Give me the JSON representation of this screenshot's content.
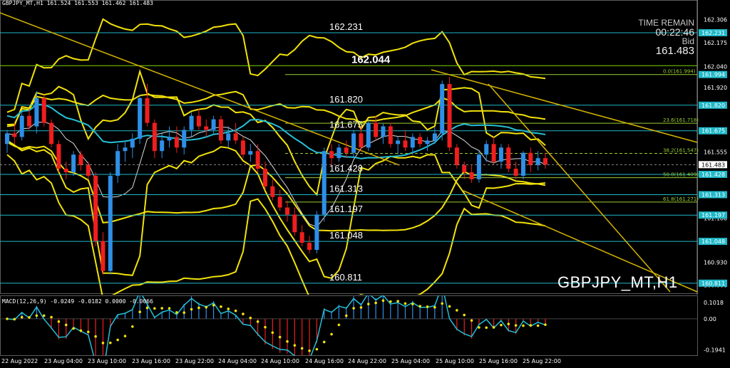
{
  "chart_title": "GBPJPY_MT,H1",
  "symbol_bar": "GBPJPY_MT,H1  161.524 161.553 161.462 161.483",
  "info": {
    "time_remain_label": "TIME REMAIN",
    "time_remain_value": "00:22:46",
    "bid_label": "Bid",
    "bid_value": "161.483"
  },
  "chart_data": {
    "type": "candlestick",
    "price_axis": {
      "ylim": [
        160.77,
        162.36
      ],
      "ticks": [
        "162.306",
        "162.175",
        "162.040",
        "161.920",
        "161.555",
        "161.180",
        "160.930",
        "160.800"
      ]
    },
    "price_level_tags": [
      "162.231",
      "161.994",
      "161.820",
      "161.675",
      "161.428",
      "161.313",
      "161.197",
      "161.048",
      "160.811"
    ],
    "current_price_tag": "161.483",
    "horizontal_levels": [
      {
        "label": "162.231",
        "value": 162.231,
        "line": "cyan",
        "label_color": "#ffffff"
      },
      {
        "label": "162.044",
        "value": 162.044,
        "line": "#7fd400",
        "label_color": "#ffffff",
        "bold": true
      },
      {
        "label": "161.820",
        "value": 161.82,
        "line": "cyan",
        "label_color": "#ffffff"
      },
      {
        "label": "161.675",
        "value": 161.675,
        "line": "cyan",
        "label_color": "#ffffff"
      },
      {
        "label": "161.428",
        "value": 161.428,
        "line": "cyan",
        "label_color": "#ffffff"
      },
      {
        "label": "161.313",
        "value": 161.313,
        "line": "cyan",
        "label_color": "#ffffff"
      },
      {
        "label": "161.197",
        "value": 161.197,
        "line": "cyan",
        "label_color": "#ffffff"
      },
      {
        "label": "161.048",
        "value": 161.048,
        "line": "cyan",
        "label_color": "#ffffff"
      },
      {
        "label": "160.811",
        "value": 160.811,
        "line": "cyan",
        "label_color": "#ffffff"
      }
    ],
    "fibo_levels": [
      {
        "label": "0.0(161.994)",
        "value": 161.994
      },
      {
        "label": "23.6(161.718)",
        "value": 161.718
      },
      {
        "label": "38.2(161.547)",
        "value": 161.547
      },
      {
        "label": "50.0(161.409)",
        "value": 161.409
      },
      {
        "label": "61.8(161.271)",
        "value": 161.271
      }
    ],
    "candles": [
      [
        161.6,
        161.68,
        161.55,
        161.66
      ],
      [
        161.66,
        161.72,
        161.6,
        161.64
      ],
      [
        161.64,
        161.78,
        161.62,
        161.76
      ],
      [
        161.76,
        161.8,
        161.68,
        161.7
      ],
      [
        161.7,
        161.9,
        161.66,
        161.86
      ],
      [
        161.86,
        161.88,
        161.7,
        161.72
      ],
      [
        161.72,
        161.74,
        161.58,
        161.6
      ],
      [
        161.6,
        161.62,
        161.44,
        161.46
      ],
      [
        161.46,
        161.5,
        161.4,
        161.44
      ],
      [
        161.44,
        161.56,
        161.42,
        161.54
      ],
      [
        161.54,
        161.56,
        161.45,
        161.48
      ],
      [
        161.48,
        161.5,
        161.4,
        161.42
      ],
      [
        161.42,
        161.44,
        161.02,
        161.05
      ],
      [
        161.05,
        161.1,
        160.86,
        160.88
      ],
      [
        160.88,
        161.44,
        160.86,
        161.42
      ],
      [
        161.42,
        161.6,
        161.38,
        161.56
      ],
      [
        161.56,
        161.62,
        161.5,
        161.58
      ],
      [
        161.58,
        161.66,
        161.52,
        161.63
      ],
      [
        161.63,
        161.88,
        161.6,
        161.86
      ],
      [
        161.86,
        161.94,
        161.7,
        161.72
      ],
      [
        161.72,
        161.74,
        161.52,
        161.56
      ],
      [
        161.56,
        161.66,
        161.52,
        161.62
      ],
      [
        161.62,
        161.7,
        161.58,
        161.64
      ],
      [
        161.64,
        161.7,
        161.55,
        161.58
      ],
      [
        161.58,
        161.7,
        161.54,
        161.68
      ],
      [
        161.68,
        161.78,
        161.64,
        161.76
      ],
      [
        161.76,
        161.8,
        161.68,
        161.7
      ],
      [
        161.7,
        161.74,
        161.64,
        161.68
      ],
      [
        161.68,
        161.76,
        161.66,
        161.74
      ],
      [
        161.74,
        161.76,
        161.6,
        161.62
      ],
      [
        161.62,
        161.7,
        161.58,
        161.66
      ],
      [
        161.66,
        161.72,
        161.6,
        161.62
      ],
      [
        161.62,
        161.64,
        161.52,
        161.54
      ],
      [
        161.54,
        161.6,
        161.5,
        161.56
      ],
      [
        161.56,
        161.6,
        161.44,
        161.46
      ],
      [
        161.46,
        161.5,
        161.34,
        161.36
      ],
      [
        161.36,
        161.4,
        161.28,
        161.3
      ],
      [
        161.3,
        161.34,
        161.22,
        161.24
      ],
      [
        161.24,
        161.28,
        161.16,
        161.2
      ],
      [
        161.2,
        161.24,
        161.08,
        161.1
      ],
      [
        161.1,
        161.14,
        161.02,
        161.04
      ],
      [
        161.04,
        161.08,
        160.98,
        161.0
      ],
      [
        161.0,
        161.22,
        160.98,
        161.2
      ],
      [
        161.2,
        161.58,
        161.16,
        161.56
      ],
      [
        161.56,
        161.6,
        161.48,
        161.52
      ],
      [
        161.52,
        161.6,
        161.5,
        161.58
      ],
      [
        161.58,
        161.62,
        161.52,
        161.55
      ],
      [
        161.55,
        161.68,
        161.52,
        161.66
      ],
      [
        161.66,
        161.7,
        161.56,
        161.58
      ],
      [
        161.58,
        161.74,
        161.56,
        161.72
      ],
      [
        161.72,
        161.76,
        161.62,
        161.64
      ],
      [
        161.64,
        161.72,
        161.6,
        161.7
      ],
      [
        161.7,
        161.72,
        161.58,
        161.6
      ],
      [
        161.6,
        161.64,
        161.54,
        161.62
      ],
      [
        161.62,
        161.68,
        161.56,
        161.58
      ],
      [
        161.58,
        161.66,
        161.54,
        161.64
      ],
      [
        161.64,
        161.66,
        161.58,
        161.6
      ],
      [
        161.6,
        161.64,
        161.56,
        161.62
      ],
      [
        161.62,
        161.7,
        161.6,
        161.66
      ],
      [
        161.66,
        161.96,
        161.62,
        161.94
      ],
      [
        161.94,
        161.98,
        161.56,
        161.58
      ],
      [
        161.58,
        161.6,
        161.46,
        161.48
      ],
      [
        161.48,
        161.5,
        161.4,
        161.44
      ],
      [
        161.44,
        161.48,
        161.38,
        161.4
      ],
      [
        161.4,
        161.56,
        161.38,
        161.54
      ],
      [
        161.54,
        161.62,
        161.5,
        161.6
      ],
      [
        161.6,
        161.64,
        161.48,
        161.5
      ],
      [
        161.5,
        161.6,
        161.46,
        161.58
      ],
      [
        161.58,
        161.6,
        161.44,
        161.46
      ],
      [
        161.46,
        161.5,
        161.4,
        161.42
      ],
      [
        161.42,
        161.56,
        161.4,
        161.55
      ],
      [
        161.55,
        161.58,
        161.44,
        161.48
      ],
      [
        161.48,
        161.56,
        161.45,
        161.52
      ],
      [
        161.52,
        161.55,
        161.46,
        161.483
      ]
    ],
    "time_labels": [
      "22 Aug 2022",
      "23 Aug 04:00",
      "23 Aug 10:00",
      "23 Aug 16:00",
      "23 Aug 22:00",
      "24 Aug 04:00",
      "24 Aug 10:00",
      "24 Aug 16:00",
      "24 Aug 22:00",
      "25 Aug 04:00",
      "25 Aug 10:00",
      "25 Aug 16:00",
      "25 Aug 22:00"
    ],
    "macd": {
      "label": "MACD(12,26,9) -0.0249 -0.0182 0.0000 -0.0066",
      "ticks": [
        "0.1018",
        "0.00",
        "-0.1941"
      ],
      "ylim": [
        -0.21,
        0.12
      ]
    }
  }
}
